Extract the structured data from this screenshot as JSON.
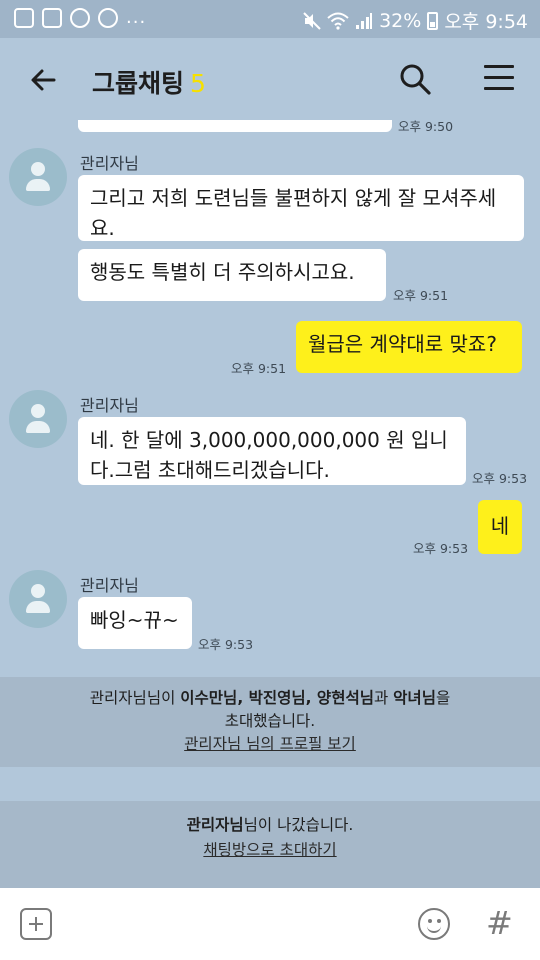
{
  "status_bar": {
    "battery": "32%",
    "time": "오후 9:54",
    "more": "..."
  },
  "header": {
    "title": "그룹채팅",
    "member_count": "5"
  },
  "messages": [
    {
      "sender": "",
      "text": "",
      "time": "오후 9:50"
    },
    {
      "sender": "관리자님",
      "text": "그리고 저희 도련님들 불편하지 않게 잘 모셔주세요.",
      "time": ""
    },
    {
      "sender": "",
      "text": "행동도 특별히 더 주의하시고요.",
      "time": "오후 9:51"
    },
    {
      "sender": "me",
      "text": "월급은 계약대로 맞죠?",
      "time": "오후 9:51"
    },
    {
      "sender": "관리자님",
      "text": "네. 한 달에 3,000,000,000,000 원 입니다.그럼 초대해드리겠습니다.",
      "time": "오후 9:53"
    },
    {
      "sender": "me",
      "text": "네",
      "time": "오후 9:53"
    },
    {
      "sender": "관리자님",
      "text": "빠잉~뀨~",
      "time": "오후 9:53"
    }
  ],
  "notices": {
    "invite": {
      "inviter": "관리자님",
      "part1": "님이 ",
      "invitees": "이수만님, 박진영님, 양현석님",
      "part2": "과 ",
      "invitee_last": "악녀님",
      "part3": "을",
      "line2": "초대했습니다.",
      "profile_link": "관리자님 님의 프로필 보기"
    },
    "left": {
      "who": "관리자님",
      "text": "님이 나갔습니다.",
      "invite_link": "채팅방으로 초대하기"
    }
  },
  "input_bar": {
    "icons": [
      "plus-icon",
      "emoji-icon",
      "hashtag-icon"
    ],
    "hash_glyph": "#"
  },
  "colors": {
    "background": "#b2c7da",
    "my_bubble": "#fef01b",
    "other_bubble": "#ffffff",
    "member_count": "#f6e000"
  }
}
